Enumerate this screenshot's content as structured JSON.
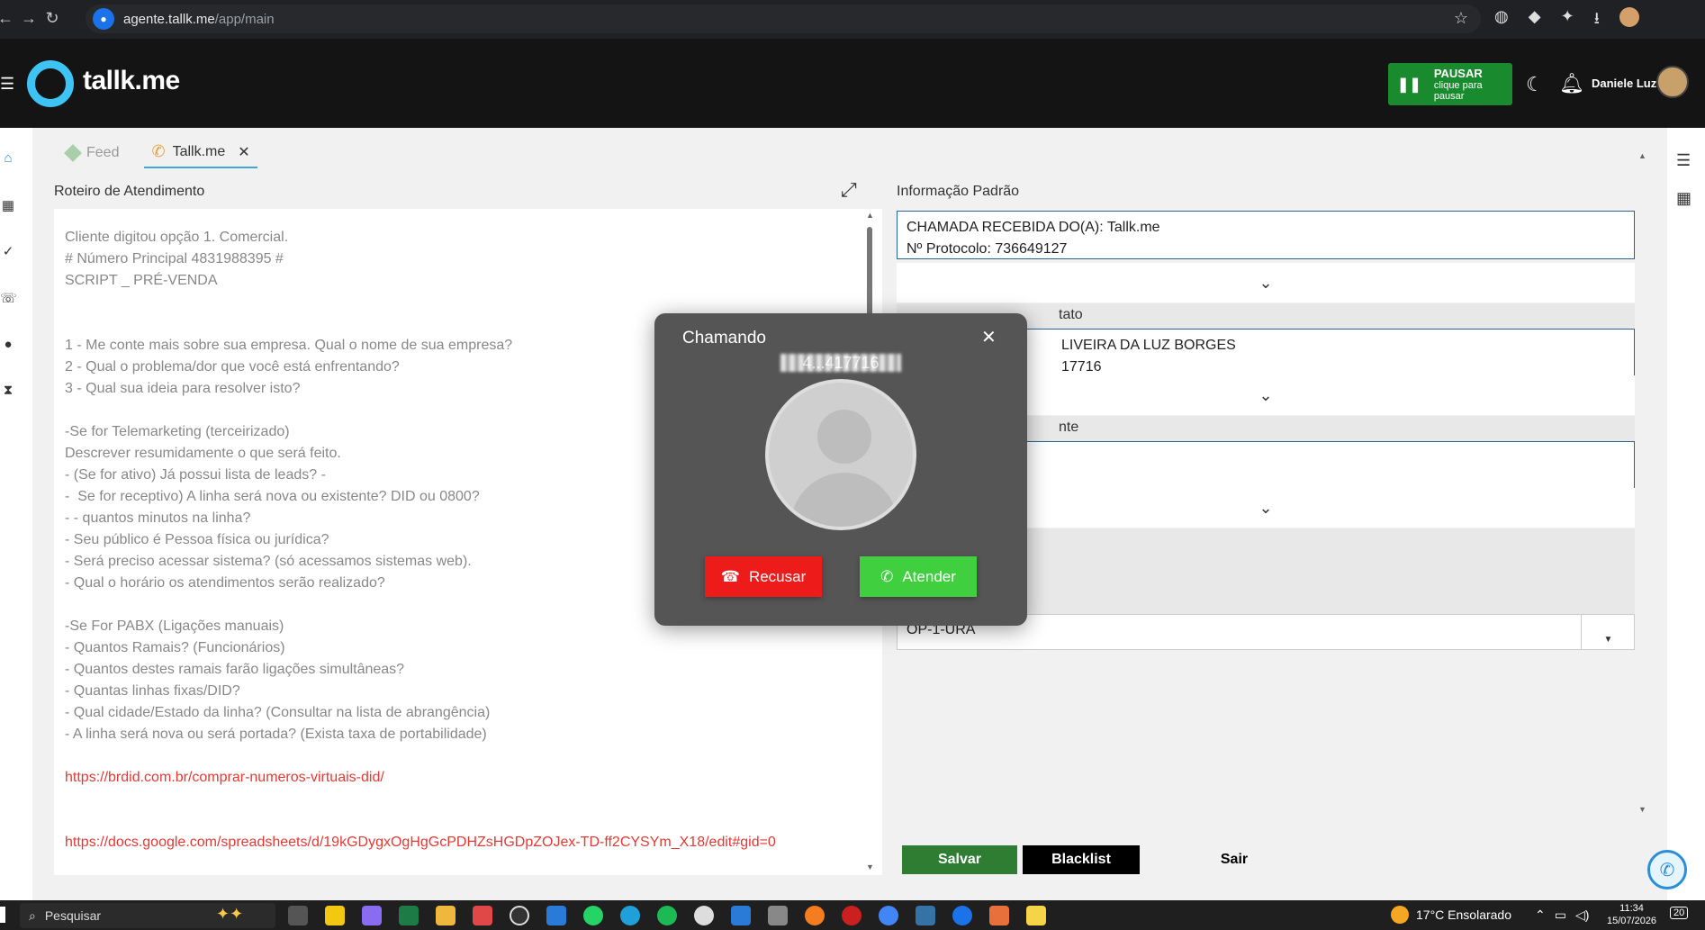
{
  "browser": {
    "url_host": "agente.tallk.me",
    "url_path": "/app/main"
  },
  "header": {
    "logo_text": "tallk.me",
    "pause_title": "PAUSAR",
    "pause_sub": "clique para pausar",
    "user_name": "Daniele Luz"
  },
  "tabs": [
    {
      "label": "Feed"
    },
    {
      "label": "Tallk.me"
    }
  ],
  "script_panel": {
    "title": "Roteiro de Atendimento",
    "lines": [
      "Cliente digitou opção 1. Comercial.",
      "# Número Principal 4831988395 #",
      "SCRIPT _ PRÉ-VENDA",
      "",
      "",
      "1 - Me conte mais sobre sua empresa. Qual o nome de sua empresa?",
      "2 - Qual o problema/dor que você está enfrentando?",
      "3 - Qual sua ideia para resolver isto?",
      "",
      "-Se for Telemarketing (terceirizado)",
      "Descrever resumidamente o que será feito.",
      "- (Se for ativo) Já possui lista de leads? -",
      "-  Se for receptivo) A linha será nova ou existente? DID ou 0800?",
      "- - quantos minutos na linha?",
      "- Seu público é Pessoa física ou jurídica?",
      "- Será preciso acessar sistema? (só acessamos sistemas web).",
      "- Qual o horário os atendimentos serão realizado?",
      "",
      "-Se For PABX (Ligações manuais)",
      "- Quantos Ramais? (Funcionários)",
      "- Quantos destes ramais farão ligações simultâneas?",
      "- Quantas linhas fixas/DID?",
      "- Qual cidade/Estado da linha? (Consultar na lista de abrangência)",
      "- A linha será nova ou será portada? (Exista taxa de portabilidade)",
      ""
    ],
    "link1": "https://brdid.com.br/comprar-numeros-virtuais-did/",
    "link2": "https://docs.google.com/spreadsheets/d/19kGDygxOgHgGcPDHZsHGDpZOJex-TD-ff2CYSYm_X18/edit#gid=0"
  },
  "info_panel": {
    "title": "Informação Padrão",
    "line1": "CHAMADA RECEBIDA DO(A):  Tallk.me",
    "line2": "Nº Protocolo:  736649127",
    "contact_label": "tato",
    "contact_line1": "LIVEIRA DA LUZ BORGES",
    "contact_line2": "17716",
    "third_label": "nte",
    "select_value": "OP-1-URA"
  },
  "actions": {
    "save": "Salvar",
    "blacklist": "Blacklist",
    "exit": "Sair"
  },
  "modal": {
    "title": "Chamando",
    "number": "4...417716",
    "decline": "Recusar",
    "answer": "Atender"
  },
  "taskbar": {
    "search": "Pesquisar",
    "weather": "17°C  Ensolarado",
    "time": "11:34",
    "date": "15/07/2026",
    "notif_count": "20"
  }
}
